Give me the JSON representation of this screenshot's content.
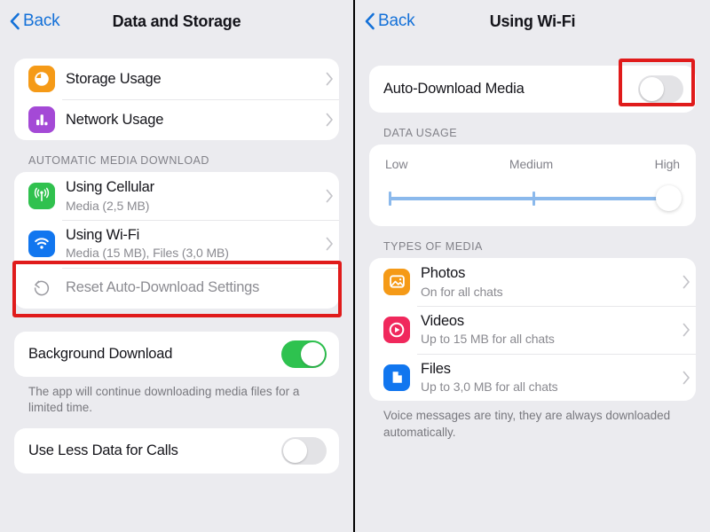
{
  "theme": {
    "page_bg": "#ebebef",
    "card_bg": "#ffffff",
    "accent_blue": "#1471d8",
    "toggle_on_green": "#2ec24f",
    "toggle_off_gray": "#e3e3e6",
    "slider_blue": "#8bb9ec",
    "highlight_red": "#e01b1b",
    "title_color": "#14141a",
    "subtitle_color": "#8a8a90",
    "section_header_color": "#818188"
  },
  "left_screen": {
    "nav": {
      "back_label": "Back",
      "back_icon": "chevron-left-icon",
      "title": "Data and Storage"
    },
    "usage_card": {
      "rows": [
        {
          "title": "Storage Usage",
          "icon": "pie-chart-icon",
          "icon_color": "#f59a17",
          "chevron": "chevron-right-icon"
        },
        {
          "title": "Network Usage",
          "icon": "bar-chart-icon",
          "icon_color": "#a449d6",
          "chevron": "chevron-right-icon"
        }
      ]
    },
    "auto_download": {
      "section_header": "AUTOMATIC MEDIA DOWNLOAD",
      "rows": [
        {
          "title": "Using Cellular",
          "subtitle": "Media (2,5 MB)",
          "icon": "cellular-antenna-icon",
          "icon_color": "#30c14e",
          "chevron": "chevron-right-icon"
        },
        {
          "title": "Using Wi-Fi",
          "subtitle": "Media (15 MB), Files (3,0 MB)",
          "icon": "wifi-icon",
          "icon_color": "#1176ef",
          "chevron": "chevron-right-icon",
          "highlighted": true
        }
      ],
      "reset_row": {
        "title": "Reset Auto-Download Settings",
        "icon": "reset-counterclockwise-icon",
        "disabled": true
      }
    },
    "background_download": {
      "label": "Background Download",
      "toggle_state": "on",
      "footer": "The app will continue downloading media files for a limited time."
    },
    "use_less_data": {
      "label": "Use Less Data for Calls",
      "toggle_state": "off"
    }
  },
  "right_screen": {
    "nav": {
      "back_label": "Back",
      "back_icon": "chevron-left-icon",
      "title": "Using Wi-Fi"
    },
    "auto_download_media": {
      "label": "Auto-Download Media",
      "toggle_state": "off",
      "highlighted": true
    },
    "data_usage": {
      "section_header": "DATA USAGE",
      "labels": [
        "Low",
        "Medium",
        "High"
      ],
      "selected": "High",
      "slider": {
        "min": 0,
        "max": 2,
        "value": 2,
        "tick_positions": [
          0,
          1
        ],
        "steps": 3
      }
    },
    "types_of_media": {
      "section_header": "TYPES OF MEDIA",
      "rows": [
        {
          "title": "Photos",
          "subtitle": "On for all chats",
          "icon": "photo-image-icon",
          "icon_color": "#f59a17",
          "chevron": "chevron-right-icon"
        },
        {
          "title": "Videos",
          "subtitle": "Up to 15 MB for all chats",
          "icon": "video-play-icon",
          "icon_color": "#f0285c",
          "chevron": "chevron-right-icon"
        },
        {
          "title": "Files",
          "subtitle": "Up to 3,0 MB for all chats",
          "icon": "document-file-icon",
          "icon_color": "#1176ef",
          "chevron": "chevron-right-icon"
        }
      ],
      "footer": "Voice messages are tiny, they are always downloaded automatically."
    }
  }
}
